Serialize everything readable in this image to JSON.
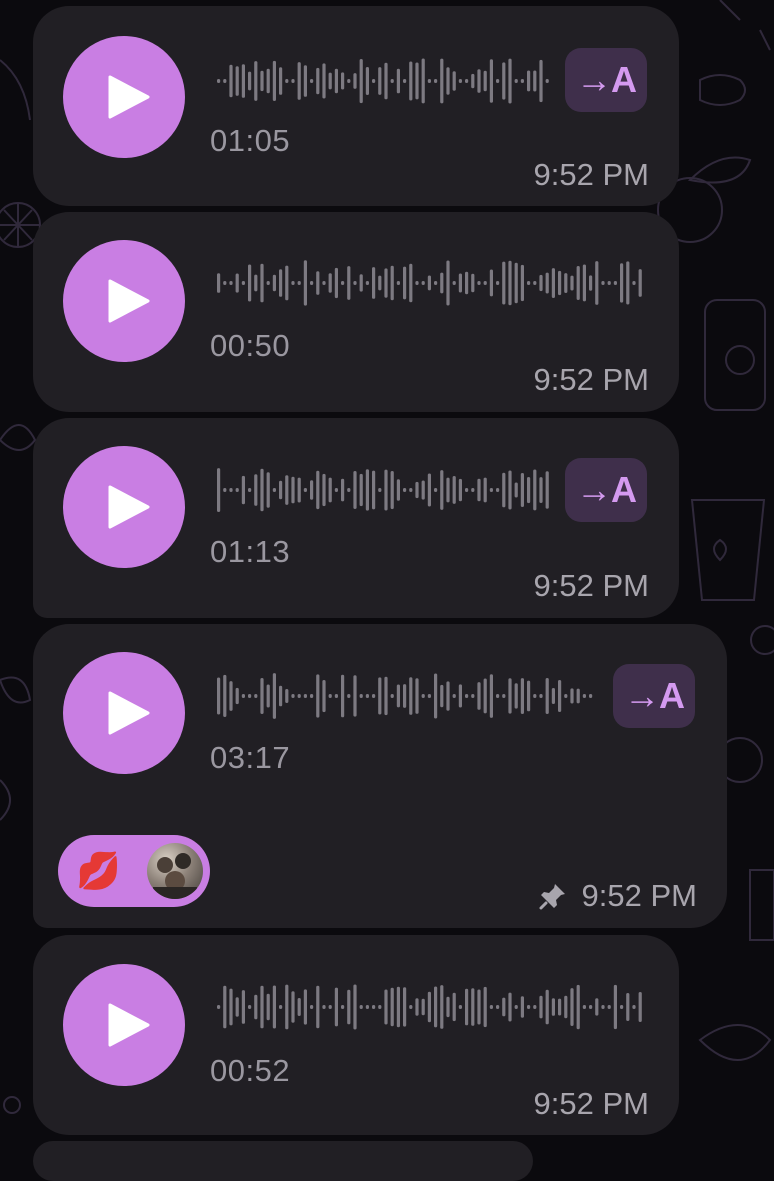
{
  "messages": [
    {
      "duration": "01:05",
      "time": "9:52 PM",
      "has_transcribe": true,
      "transcribe_label": "→A"
    },
    {
      "duration": "00:50",
      "time": "9:52 PM",
      "has_transcribe": false
    },
    {
      "duration": "01:13",
      "time": "9:52 PM",
      "has_transcribe": true,
      "transcribe_label": "→A"
    },
    {
      "duration": "03:17",
      "time": "9:52 PM",
      "has_transcribe": true,
      "transcribe_label": "→A",
      "pinned": true,
      "reaction": {
        "emoji": "💋",
        "icon": "kiss-mark-icon"
      }
    },
    {
      "duration": "00:52",
      "time": "9:52 PM",
      "has_transcribe": false
    }
  ],
  "colors": {
    "accent": "#c97ee3",
    "bubble": "#211f24",
    "background": "#0b0a0e",
    "transcribe_bg": "#3f2f4b",
    "transcribe_fg": "#d49af0"
  },
  "icons": {
    "play": "play-icon",
    "transcribe": "transcribe-icon",
    "pin": "pin-icon",
    "waveform": "waveform-icon"
  }
}
